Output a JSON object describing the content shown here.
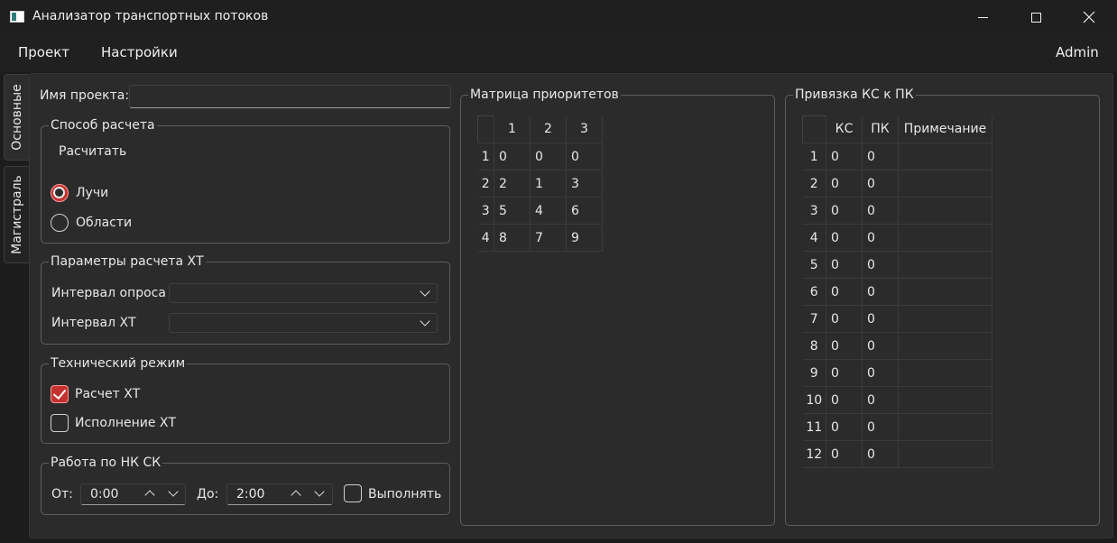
{
  "window": {
    "title": "Анализатор транспортных потоков"
  },
  "menu": {
    "project": "Проект",
    "settings": "Настройки",
    "user": "Admin"
  },
  "side_tabs": {
    "main": "Основные",
    "trunk": "Магистраль"
  },
  "project": {
    "name_label": "Имя проекта:",
    "name_value": ""
  },
  "calc_method": {
    "title": "Способ расчета",
    "calc_button": "Расчитать",
    "options": [
      {
        "label": "Лучи",
        "selected": true
      },
      {
        "label": "Области",
        "selected": false
      }
    ]
  },
  "xt_params": {
    "title": "Параметры расчета ХТ",
    "poll_interval_label": "Интервал опроса",
    "poll_interval_value": "",
    "xt_interval_label": "Интервал ХТ",
    "xt_interval_value": ""
  },
  "tech_mode": {
    "title": "Технический режим",
    "calc_xt": {
      "label": "Расчет ХТ",
      "checked": true
    },
    "exec_xt": {
      "label": "Исполнение ХТ",
      "checked": false
    }
  },
  "nk_sk": {
    "title": "Работа по НК СК",
    "from_label": "От:",
    "from_value": "0:00",
    "to_label": "До:",
    "to_value": "2:00",
    "execute": {
      "label": "Выполнять",
      "checked": false
    }
  },
  "priority_matrix": {
    "title": "Матрица приоритетов",
    "columns": [
      "1",
      "2",
      "3"
    ],
    "rows": [
      {
        "header": "1",
        "cells": [
          "0",
          "0",
          "0"
        ]
      },
      {
        "header": "2",
        "cells": [
          "2",
          "1",
          "3"
        ]
      },
      {
        "header": "3",
        "cells": [
          "5",
          "4",
          "6"
        ]
      },
      {
        "header": "4",
        "cells": [
          "8",
          "7",
          "9"
        ]
      }
    ]
  },
  "ks_pk": {
    "title": "Привязка КС к ПК",
    "columns": [
      "КС",
      "ПК",
      "Примечание"
    ],
    "rows": [
      {
        "header": "1",
        "cells": [
          "0",
          "0",
          ""
        ]
      },
      {
        "header": "2",
        "cells": [
          "0",
          "0",
          ""
        ]
      },
      {
        "header": "3",
        "cells": [
          "0",
          "0",
          ""
        ]
      },
      {
        "header": "4",
        "cells": [
          "0",
          "0",
          ""
        ]
      },
      {
        "header": "5",
        "cells": [
          "0",
          "0",
          ""
        ]
      },
      {
        "header": "6",
        "cells": [
          "0",
          "0",
          ""
        ]
      },
      {
        "header": "7",
        "cells": [
          "0",
          "0",
          ""
        ]
      },
      {
        "header": "8",
        "cells": [
          "0",
          "0",
          ""
        ]
      },
      {
        "header": "9",
        "cells": [
          "0",
          "0",
          ""
        ]
      },
      {
        "header": "10",
        "cells": [
          "0",
          "0",
          ""
        ]
      },
      {
        "header": "11",
        "cells": [
          "0",
          "0",
          ""
        ]
      },
      {
        "header": "12",
        "cells": [
          "0",
          "0",
          ""
        ]
      }
    ]
  },
  "colors": {
    "accent": "#c4322f",
    "background": "#2b2b2b",
    "titlebar": "#1f1f1f"
  }
}
